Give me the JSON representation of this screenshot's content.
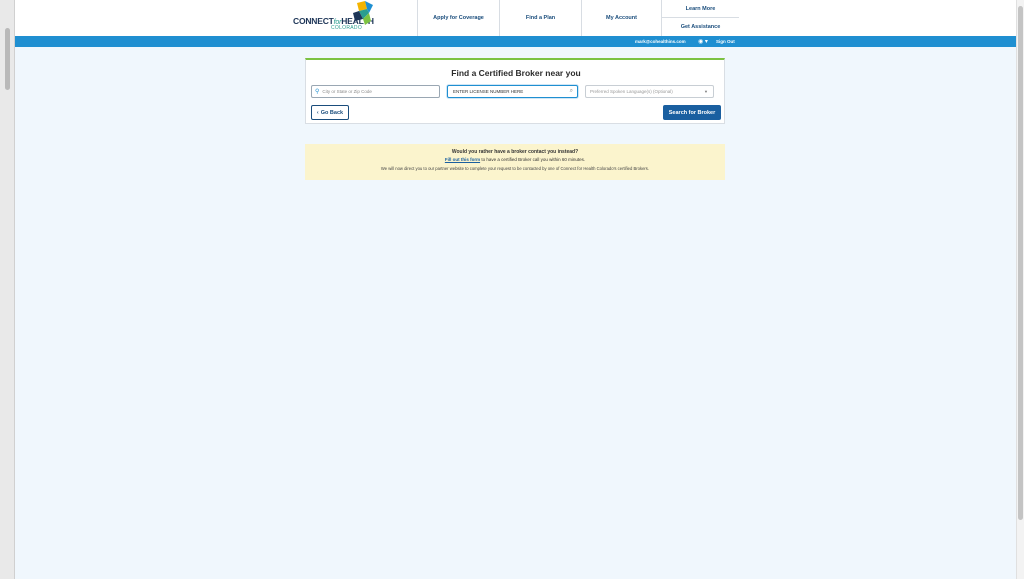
{
  "header": {
    "logo": {
      "part1": "CONNECT",
      "part2": "for",
      "part3": "HEALTH",
      "sub": "COLORADO",
      "colors": [
        "#f4b400",
        "#2a9d8f",
        "#1f8fd1",
        "#1d3557"
      ]
    },
    "nav": {
      "apply": "Apply for Coverage",
      "find_plan": "Find a Plan",
      "my_account": "My Account",
      "learn_more": "Learn More",
      "get_assistance": "Get Assistance"
    }
  },
  "userbar": {
    "email": "mark@cohealthins.com",
    "globe_icon": "globe-icon",
    "sign_out": "Sign Out",
    "color": "#1f8fd1"
  },
  "search": {
    "title": "Find a Certified Broker near you",
    "city_placeholder": "City or State or Zip Code",
    "license_value": "ENTER LICENSE NUMBER HERE",
    "language_placeholder": "Preferred Spoken Language(s) (Optional)",
    "go_back": "Go Back",
    "search_button": "Search for Broker",
    "accent_color": "#7cc242"
  },
  "notice": {
    "title": "Would you rather have a broker contact you instead?",
    "link": "Fill out this form",
    "line1_rest": " to have a certified Broker call you within 60 minutes.",
    "line2": "We will now direct you to our partner website to complete your request to be contacted by one of Connect for Health Colorado's certified Brokers.",
    "background": "#fbf4cd"
  }
}
